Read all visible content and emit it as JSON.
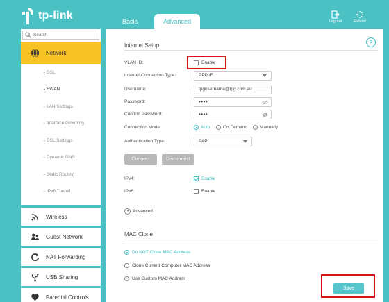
{
  "header": {
    "brand": "tp-link",
    "tabs": [
      "Basic",
      "Advanced"
    ],
    "logout_label": "Log out",
    "reboot_label": "Reboot"
  },
  "sidebar": {
    "search_placeholder": "Search",
    "active_item": "Network",
    "sub_items": [
      "- DSL",
      "- EWAN",
      "- LAN Settings",
      "- Interface Grouping",
      "- DSL Settings",
      "- Dynamic DNS",
      "- Static Routing",
      "- IPv6 Tunnel"
    ],
    "current_sub_item": "- EWAN",
    "items": [
      "Wireless",
      "Guest Network",
      "NAT Forwarding",
      "USB Sharing",
      "Parental Controls"
    ]
  },
  "internet_setup": {
    "title": "Internet Setup",
    "vlan_label": "VLAN ID:",
    "vlan_enable": "Enable",
    "connection_type_label": "Internet Connection Type:",
    "connection_type_value": "PPPoE",
    "username_label": "Username:",
    "username_value": "tpgusername@tpg.com.au",
    "password_label": "Password:",
    "password_value": "••••",
    "confirm_password_label": "Confirm Password:",
    "confirm_password_value": "••••",
    "connection_mode_label": "Connection Mode:",
    "connection_modes": [
      "Auto",
      "On Demand",
      "Manually"
    ],
    "auth_type_label": "Authentication Type:",
    "auth_type_value": "PAP",
    "connect_label": "Connect",
    "disconnect_label": "Disconnect",
    "ipv4_label": "IPv4:",
    "ipv4_enable": "Enable",
    "ipv6_label": "IPv6:",
    "ipv6_enable": "Enable",
    "advanced_label": "Advanced"
  },
  "mac_clone": {
    "title": "MAC Clone",
    "options": [
      "Do NOT Clone MAC Address",
      "Clone Current Computer MAC Address",
      "Use Custom MAC Address"
    ]
  },
  "save_label": "Save",
  "colors": {
    "teal": "#4cc1c3",
    "accent": "#3dbfc1",
    "active_nav": "#f6c224",
    "highlight": "#d8161a"
  }
}
